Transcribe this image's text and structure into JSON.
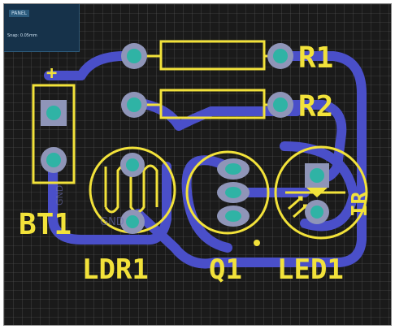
{
  "info_panel": {
    "title": "PANEL",
    "text": "Snap: 0.05mm"
  },
  "designators": {
    "r1": "R1",
    "r2": "R2",
    "bt1": "BT1",
    "ldr1": "LDR1",
    "q1": "Q1",
    "led1": "LED1",
    "ir": "IR",
    "plus": "+",
    "gnd_ghost": "GND",
    "tag_ghost": "GND"
  },
  "colors": {
    "board": "#1a1a1a",
    "grid": "#6a6a6a",
    "copper": "#4a4fc9",
    "silkscreen": "#f2e23a",
    "pad": "#2fb3a5",
    "pad_ring": "#8f95b8"
  }
}
